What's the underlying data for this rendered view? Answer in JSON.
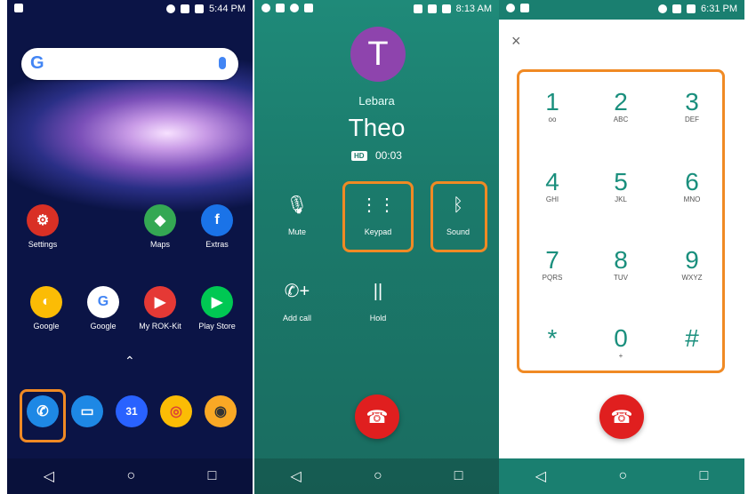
{
  "home": {
    "status": {
      "time": "5:44 PM"
    },
    "search": {
      "logo": "G"
    },
    "apps_row1": [
      {
        "label": "Settings",
        "color": "#d93025",
        "glyph": "⚙"
      },
      {
        "label": "Maps",
        "color": "#34a853",
        "glyph": "◆"
      },
      {
        "label": "Extras",
        "color": "#1a73e8",
        "glyph": "f"
      }
    ],
    "apps_row2": [
      {
        "label": "Google",
        "color": "#fbbc05",
        "glyph": "◐"
      },
      {
        "label": "Google",
        "color": "#ffffff",
        "glyph": "G"
      },
      {
        "label": "My ROK-Kit",
        "color": "#e53935",
        "glyph": "▶"
      },
      {
        "label": "Play Store",
        "color": "#00c853",
        "glyph": "▶"
      }
    ],
    "dock": [
      {
        "name": "phone",
        "color": "#1e88e5",
        "glyph": "✆"
      },
      {
        "name": "messages",
        "color": "#1e88e5",
        "glyph": "▭"
      },
      {
        "name": "calendar",
        "color": "#2962ff",
        "glyph": "31"
      },
      {
        "name": "chrome",
        "color": "#fbbc05",
        "glyph": "◎"
      },
      {
        "name": "camera",
        "color": "#f9a825",
        "glyph": "◉"
      }
    ]
  },
  "call": {
    "status": {
      "time": "8:13 AM"
    },
    "avatar_letter": "T",
    "carrier": "Lebara",
    "name": "Theo",
    "hd": "HD",
    "duration": "00:03",
    "controls": [
      {
        "label": "Mute",
        "glyph": "🎙"
      },
      {
        "label": "Keypad",
        "glyph": "⋮⋮"
      },
      {
        "label": "Sound",
        "glyph": "ᛒ"
      },
      {
        "label": "Add call",
        "glyph": "✆+"
      },
      {
        "label": "Hold",
        "glyph": "||"
      }
    ]
  },
  "dial": {
    "status": {
      "time": "6:31 PM"
    },
    "close": "×",
    "keys": [
      {
        "digit": "1",
        "letters": "ᴏᴏ"
      },
      {
        "digit": "2",
        "letters": "ABC"
      },
      {
        "digit": "3",
        "letters": "DEF"
      },
      {
        "digit": "4",
        "letters": "GHI"
      },
      {
        "digit": "5",
        "letters": "JKL"
      },
      {
        "digit": "6",
        "letters": "MNO"
      },
      {
        "digit": "7",
        "letters": "PQRS"
      },
      {
        "digit": "8",
        "letters": "TUV"
      },
      {
        "digit": "9",
        "letters": "WXYZ"
      },
      {
        "digit": "*",
        "letters": ""
      },
      {
        "digit": "0",
        "letters": "+"
      },
      {
        "digit": "#",
        "letters": ""
      }
    ]
  },
  "nav": {
    "back": "◁",
    "home": "○",
    "recents": "□"
  },
  "colors": {
    "highlight": "#f08a24",
    "teal": "#1a8f7d",
    "end_call": "#e01f1f"
  }
}
